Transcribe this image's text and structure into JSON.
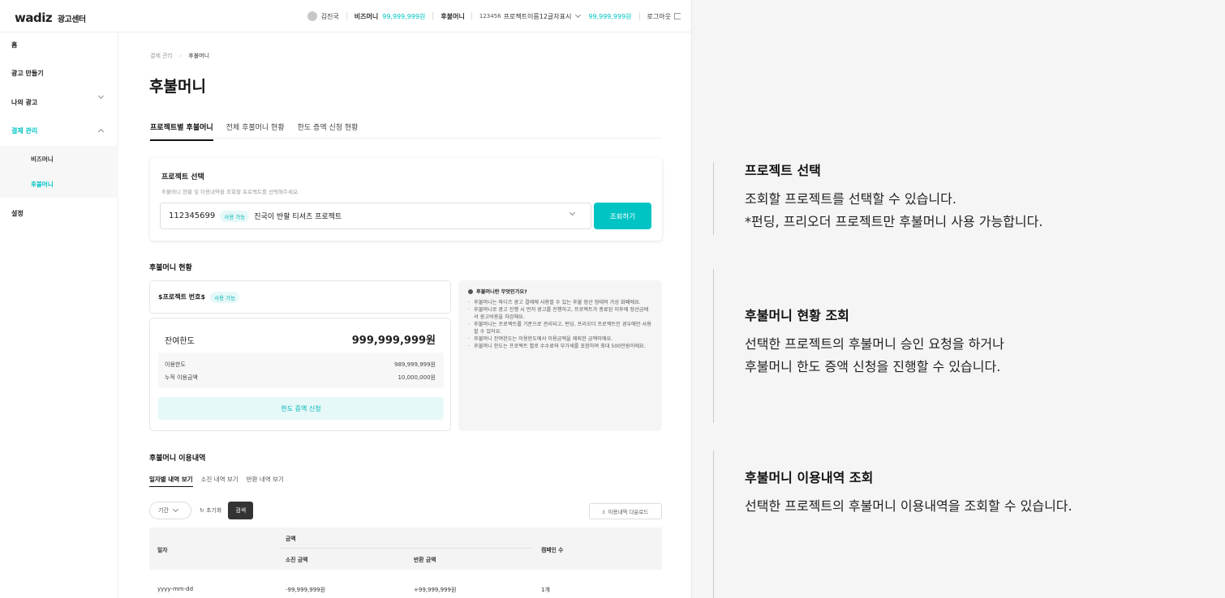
{
  "header": {
    "logo": "wadiz",
    "logo_sub": "광고센터",
    "user_name": "김진국",
    "bizmoney_label": "비즈머니",
    "bizmoney_value": "99,999,999원",
    "postpay_label": "후불머니",
    "project_code": "123456",
    "project_name": "프로젝트이름12글자표시",
    "postpay_value": "99,999,999원",
    "logout": "로그아웃"
  },
  "sidebar": {
    "items": [
      "홈",
      "광고 만들기",
      "나의 광고",
      "결제 관리",
      "설정"
    ],
    "sub_items": [
      "비즈머니",
      "후불머니"
    ]
  },
  "breadcrumb": {
    "parent": "결제 관리",
    "current": "후불머니"
  },
  "page_title": "후불머니",
  "tabs": [
    "프로젝트별 후불머니",
    "전체 후불머니 현황",
    "한도 증액 신청 현황"
  ],
  "project_select": {
    "title": "프로젝트 선택",
    "desc": "후불머니 현황 및 이용내역을 조회할 프로젝트를 선택해주세요.",
    "project_id": "112345699",
    "badge": "사용 가능",
    "project_name": "진국이 반팔 티셔츠 프로젝트",
    "button": "조회하기"
  },
  "status": {
    "title": "후불머니 현황",
    "project_number": "$프로젝트 번호$",
    "badge": "사용 가능",
    "remaining_label": "잔여한도",
    "remaining_value": "999,999,999원",
    "limit_label": "이용한도",
    "limit_value": "989,999,999원",
    "used_label": "누적 이용금액",
    "used_value": "10,000,000원",
    "increase_button": "한도 증액 신청"
  },
  "faq": {
    "title": "후불머니란 무엇인가요?",
    "items": [
      "후불머니는 와디즈 광고 결제에 사용할 수 있는 후불 정산 형태의 가상 화폐에요.",
      "후불머니로 광고 진행 시 먼저 광고를 진행하고, 프로젝트가 종료된 이후에 정산금에서 광고비용을 차감해요.",
      "후불머니는 프로젝트를 기준으로 관리되고, 펀딩, 프리오더 프로젝트인 경우에만 사용할 수 있어요.",
      "후불머니 잔여한도는 이용한도에서 이용금액을 제외한 금액이에요.",
      "후불머니 한도는 프로젝트 별로 수수료와 부가세를 포함하여 최대 500만원이에요."
    ]
  },
  "history": {
    "title": "후불머니 이용내역",
    "subtabs": [
      "일자별 내역 보기",
      "소진 내역 보기",
      "반환 내역 보기"
    ],
    "period": "기간",
    "reset": "초기화",
    "search": "검색",
    "download": "이용내역 다운로드",
    "columns": {
      "date": "일자",
      "amount": "금액",
      "spent": "소진 금액",
      "returned": "반환 금액",
      "campaigns": "캠페인 수"
    },
    "rows": [
      {
        "date": "yyyy-mm-dd",
        "spent": "-99,999,999원",
        "returned": "+99,999,999원",
        "campaigns": "1개"
      }
    ]
  },
  "annotations": [
    {
      "title": "프로젝트 선택",
      "lines": [
        "조회할 프로젝트를 선택할 수 있습니다.",
        "*펀딩, 프리오더 프로젝트만 후불머니 사용 가능합니다."
      ]
    },
    {
      "title": "후불머니 현황 조회",
      "lines": [
        "선택한 프로젝트의 후불머니 승인 요청을 하거나",
        "후불머니 한도 증액 신청을 진행할 수 있습니다."
      ]
    },
    {
      "title": "후불머니 이용내역 조회",
      "lines": [
        "선택한 프로젝트의 후불머니 이용내역을 조회할 수 있습니다."
      ]
    }
  ],
  "colors": {
    "accent": "#00c4c4",
    "accent_light": "#e6f8f8"
  }
}
